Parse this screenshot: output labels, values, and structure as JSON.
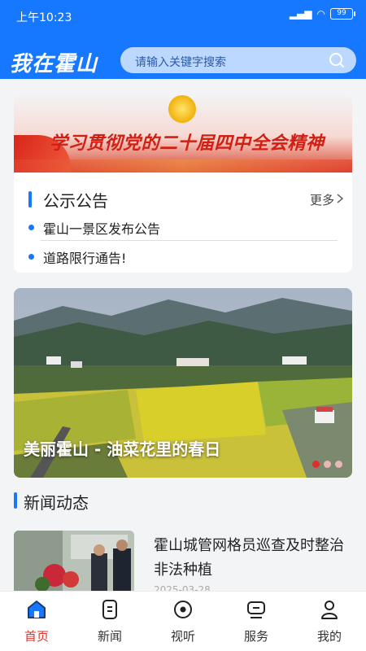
{
  "status": {
    "time": "上午10:23",
    "battery": "99"
  },
  "header": {
    "logo": "我在霍山",
    "search_placeholder": "请输入关键字搜索"
  },
  "banner": {
    "slogan": "学习贯彻党的二十届四中全会精神"
  },
  "notices": {
    "title": "公示公告",
    "more": "更多",
    "items": [
      {
        "text": "霍山一景区发布公告"
      },
      {
        "text": "道路限行通告!"
      }
    ]
  },
  "carousel": {
    "caption": "美丽霍山 - 油菜花里的春日",
    "page_count": 3,
    "active_index": 0
  },
  "news": {
    "title": "新闻动态",
    "items": [
      {
        "headline": "霍山城管网格员巡查及时整治非法种植",
        "date": "2025-03-28"
      }
    ]
  },
  "tabs": [
    {
      "label": "首页",
      "icon": "home-icon",
      "active": true
    },
    {
      "label": "新闻",
      "icon": "news-icon",
      "active": false
    },
    {
      "label": "视听",
      "icon": "media-icon",
      "active": false
    },
    {
      "label": "服务",
      "icon": "service-icon",
      "active": false
    },
    {
      "label": "我的",
      "icon": "user-icon",
      "active": false
    }
  ],
  "colors": {
    "primary": "#1677ff",
    "active_tab": "#e0322b"
  }
}
